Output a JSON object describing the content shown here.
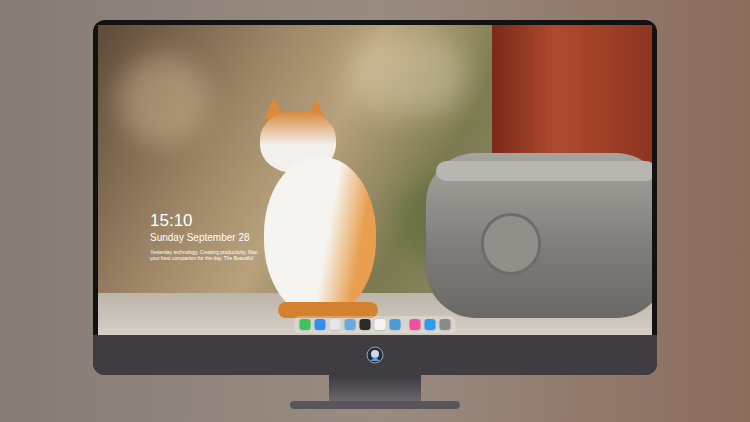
{
  "screen": {
    "clock": {
      "time": "15:10",
      "date": "Sunday September 28"
    },
    "caption": [
      "Yesterday technology. Creating productivity. Mac",
      "your best companion for the day. The Beautiful"
    ]
  },
  "dock": {
    "items": [
      {
        "kind": "app",
        "color": "#3ec55a"
      },
      {
        "kind": "app",
        "color": "#2f8ef5"
      },
      {
        "kind": "app",
        "color": "#e6e6e6"
      },
      {
        "kind": "app",
        "color": "#6aa8e0"
      },
      {
        "kind": "app",
        "color": "#2a2a2a"
      },
      {
        "kind": "app",
        "color": "#f4f4f4"
      },
      {
        "kind": "app",
        "color": "#4a9ad8"
      },
      {
        "kind": "separator",
        "color": "#d0d0d0"
      },
      {
        "kind": "app",
        "color": "#f0509a"
      },
      {
        "kind": "app",
        "color": "#2d9cf0"
      },
      {
        "kind": "app",
        "color": "#8a8a8a"
      }
    ]
  }
}
